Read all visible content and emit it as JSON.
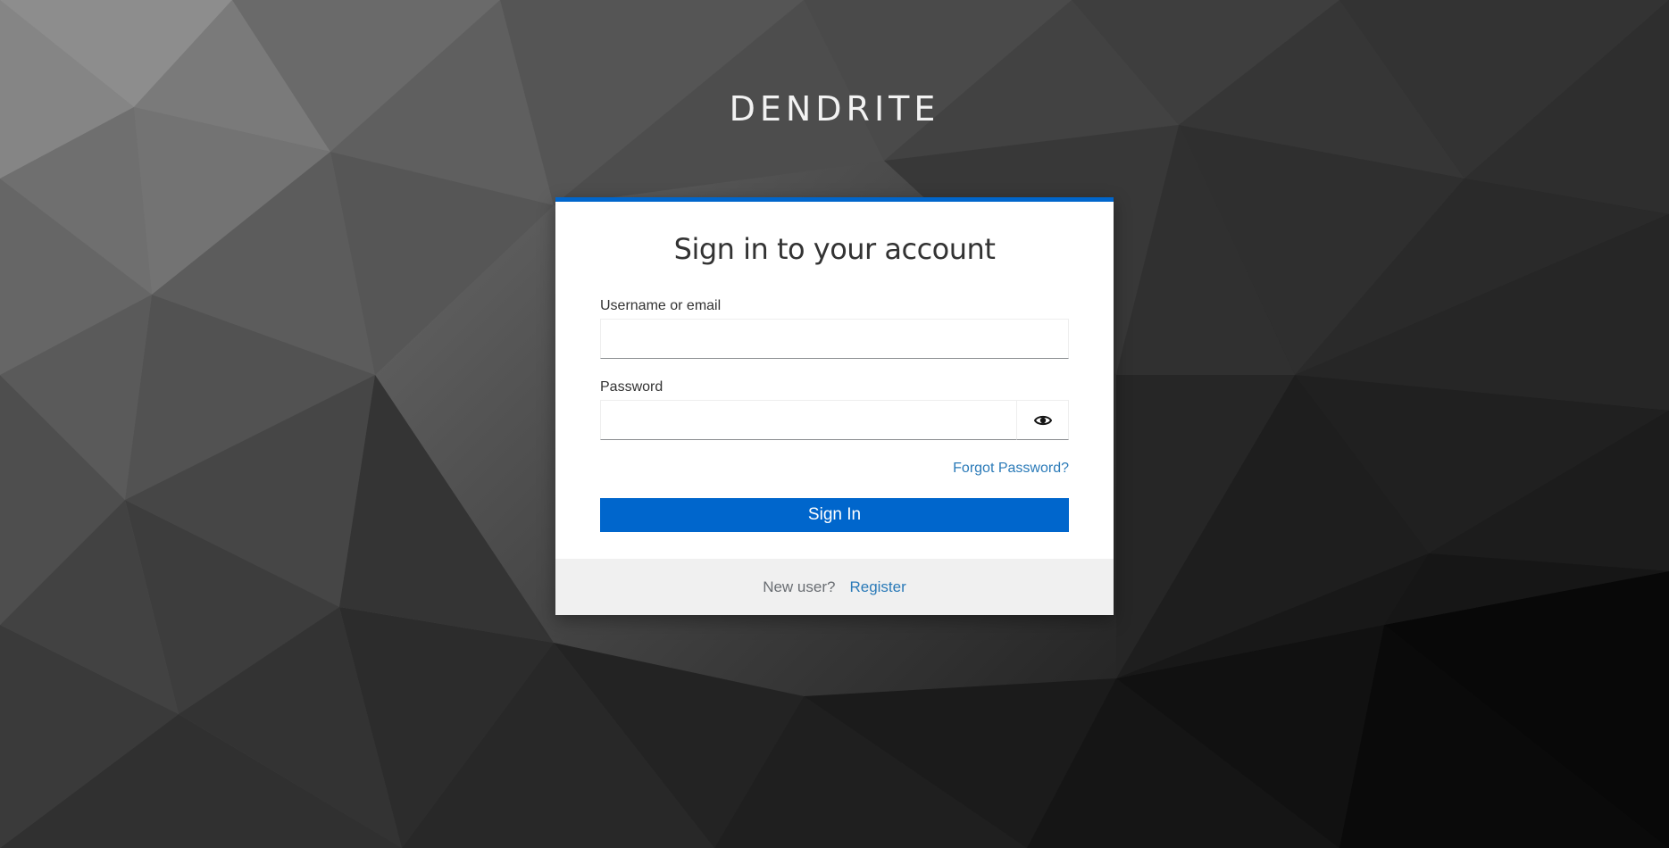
{
  "brand": {
    "name": "DENDRITE"
  },
  "login": {
    "title": "Sign in to your account",
    "username": {
      "label": "Username or email",
      "value": "",
      "placeholder": ""
    },
    "password": {
      "label": "Password",
      "value": "",
      "placeholder": "",
      "toggle_icon": "eye-icon"
    },
    "forgot_password": "Forgot Password?",
    "submit_label": "Sign In"
  },
  "footer": {
    "prompt": "New user?",
    "register_link": "Register"
  },
  "colors": {
    "accent": "#0066cc",
    "link": "#2a7ab8",
    "footer_bg": "#f0f0f0",
    "card_bg": "#ffffff"
  }
}
